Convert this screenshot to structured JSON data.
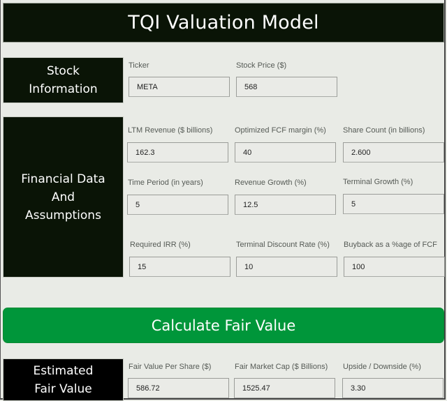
{
  "header": {
    "title": "TQI Valuation Model"
  },
  "sections": {
    "stock_info": {
      "title": "Stock\nInformation",
      "fields": [
        {
          "label": "Ticker",
          "value": "META"
        },
        {
          "label": "Stock Price ($)",
          "value": "568"
        }
      ]
    },
    "financial": {
      "title": "Financial Data\nAnd\nAssumptions",
      "fields": [
        {
          "label": "LTM Revenue ($ billions)",
          "value": "162.3"
        },
        {
          "label": "Optimized FCF margin (%)",
          "value": "40"
        },
        {
          "label": "Share Count (in billions)",
          "value": "2.600"
        },
        {
          "label": "Time Period (in years)",
          "value": "5"
        },
        {
          "label": "Revenue Growth (%)",
          "value": "12.5"
        },
        {
          "label": "Terminal Growth (%)",
          "value": "5"
        },
        {
          "label": "Required IRR (%)",
          "value": "15"
        },
        {
          "label": "Terminal Discount Rate (%)",
          "value": "10"
        },
        {
          "label": "Buyback as a %age of FCF",
          "value": "100"
        }
      ]
    },
    "fair_value": {
      "title": "Estimated\nFair Value",
      "fields": [
        {
          "label": "Fair Value Per Share ($)",
          "value": "586.72"
        },
        {
          "label": "Fair Market Cap ($ Billions)",
          "value": "1525.47"
        },
        {
          "label": "Upside / Downside (%)",
          "value": "3.30"
        }
      ]
    }
  },
  "actions": {
    "calculate_label": "Calculate Fair Value"
  },
  "colors": {
    "header_bg": "#0a1406",
    "panel_bg": "#0a1406",
    "result_panel_bg": "#000000",
    "button_bg": "#00963a",
    "page_bg": "#e9ebe6"
  }
}
